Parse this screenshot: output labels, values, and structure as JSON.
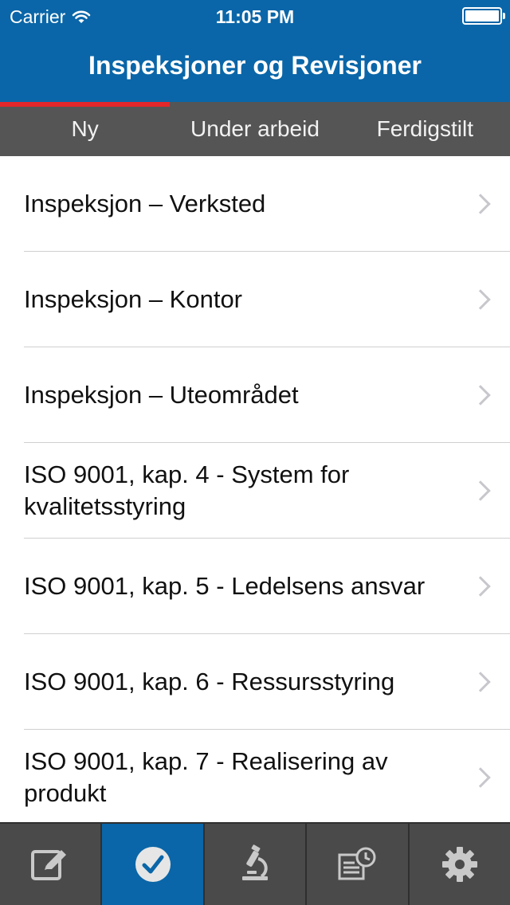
{
  "status_bar": {
    "carrier": "Carrier",
    "time": "11:05 PM"
  },
  "nav": {
    "title": "Inspeksjoner og Revisjoner"
  },
  "segments": [
    {
      "label": "Ny",
      "active": true
    },
    {
      "label": "Under arbeid",
      "active": false
    },
    {
      "label": "Ferdigstilt",
      "active": false
    }
  ],
  "list": {
    "items": [
      {
        "label": "Inspeksjon – Verksted"
      },
      {
        "label": "Inspeksjon – Kontor"
      },
      {
        "label": "Inspeksjon – Uteområdet"
      },
      {
        "label": "ISO 9001, kap. 4 - System for kvalitetsstyring"
      },
      {
        "label": "ISO 9001, kap. 5 - Ledelsens ansvar"
      },
      {
        "label": "ISO 9001, kap. 6 - Ressursstyring"
      },
      {
        "label": "ISO 9001, kap. 7 - Realisering av produkt"
      }
    ]
  },
  "tabbar": {
    "tabs": [
      {
        "icon": "edit-icon",
        "active": false
      },
      {
        "icon": "checkmark-icon",
        "active": true
      },
      {
        "icon": "microscope-icon",
        "active": false
      },
      {
        "icon": "report-clock-icon",
        "active": false
      },
      {
        "icon": "gear-icon",
        "active": false
      }
    ]
  },
  "colors": {
    "header": "#0a66a8",
    "accent": "#e3272a",
    "segbar": "#555555",
    "tabbar": "#4a4a4a"
  }
}
